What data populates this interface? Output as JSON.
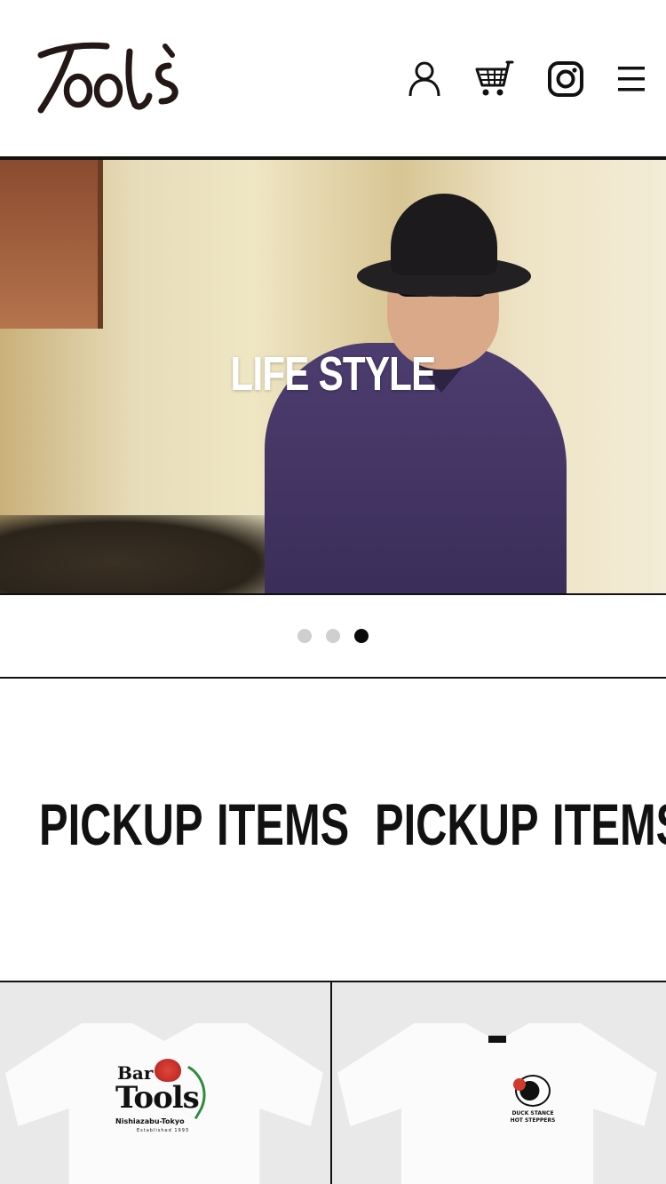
{
  "header": {
    "logo_text": "Tools",
    "icons": {
      "account": "user-icon",
      "cart": "cart-icon",
      "instagram": "instagram-icon",
      "menu": "hamburger-menu-icon"
    }
  },
  "hero": {
    "title": "LIFE STYLE",
    "slides": [
      {
        "active": false
      },
      {
        "active": false
      },
      {
        "active": true
      }
    ]
  },
  "ticker": {
    "words": [
      "PICKUP",
      "ITEMS",
      "PICKUP",
      "ITEMS"
    ]
  },
  "products": [
    {
      "print_lines": [
        "Bar",
        "Tools",
        "Nishiazabu-Tokyo",
        "Established 1993"
      ]
    },
    {
      "print_lines": [
        "DUCK STANCE",
        "HOT STEPPERS"
      ]
    }
  ],
  "colors": {
    "text": "#111111",
    "background": "#ffffff",
    "dot_inactive": "#cfcfcf",
    "dot_active": "#0a0a0a"
  }
}
